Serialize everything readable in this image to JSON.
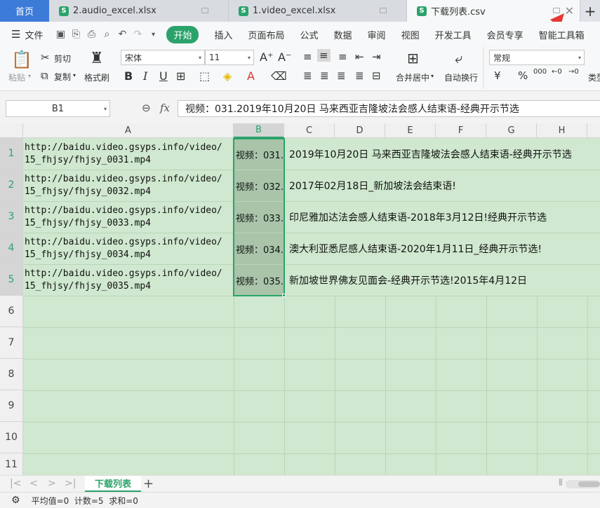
{
  "tabs": {
    "home": "首页",
    "files": [
      {
        "name": "2.audio_excel.xlsx",
        "icon": "S"
      },
      {
        "name": "1.video_excel.xlsx",
        "icon": "S"
      },
      {
        "name": "下载列表.csv",
        "icon": "S"
      }
    ],
    "add": "+"
  },
  "menu": {
    "file": "文件",
    "start": "开始",
    "items": [
      "插入",
      "页面布局",
      "公式",
      "数据",
      "审阅",
      "视图",
      "开发工具",
      "会员专享",
      "智能工具箱"
    ]
  },
  "ribbon": {
    "paste": "粘贴",
    "cut": "剪切",
    "copy": "复制",
    "format_painter": "格式刷",
    "font_name": "宋体",
    "font_size": "11",
    "merge_center": "合并居中",
    "wrap_text": "自动换行",
    "number_format": "常规",
    "type_convert": "类型",
    "currency": "¥",
    "percent": "%",
    "thousands": "000"
  },
  "formula_bar": {
    "cell_ref": "B1",
    "fx": "fx",
    "content": "视频：031.2019年10月20日 马来西亚吉隆坡法会感人结束语-经典开示节选"
  },
  "columns": [
    "A",
    "B",
    "C",
    "D",
    "E",
    "F",
    "G",
    "H"
  ],
  "rows": [
    "1",
    "2",
    "3",
    "4",
    "5",
    "6",
    "7",
    "8",
    "9",
    "10",
    "11"
  ],
  "cells": [
    {
      "a1": "http://baidu.video.gsyps.info/video/",
      "a2": "15_fhjsy/fhjsy_0031.mp4",
      "b": "视频：031.",
      "c": "2019年10月20日 马来西亚吉隆坡法会感人结束语-经典开示节选"
    },
    {
      "a1": "http://baidu.video.gsyps.info/video/",
      "a2": "15_fhjsy/fhjsy_0032.mp4",
      "b": "视频：032.",
      "c": "2017年02月18日_新加坡法会结束语!"
    },
    {
      "a1": "http://baidu.video.gsyps.info/video/",
      "a2": "15_fhjsy/fhjsy_0033.mp4",
      "b": "视频：033.",
      "c": "印尼雅加达法会感人结束语-2018年3月12日!经典开示节选"
    },
    {
      "a1": "http://baidu.video.gsyps.info/video/",
      "a2": "15_fhjsy/fhjsy_0034.mp4",
      "b": "视频：034.",
      "c": "澳大利亚悉尼感人结束语-2020年1月11日_经典开示节选!"
    },
    {
      "a1": "http://baidu.video.gsyps.info/video/",
      "a2": "15_fhjsy/fhjsy_0035.mp4",
      "b": "视频：035.",
      "c": "新加坡世界佛友见面会-经典开示节选!2015年4月12日"
    }
  ],
  "sheet": {
    "tab": "下载列表",
    "add": "+"
  },
  "status": {
    "text": "平均值=0  计数=5  求和=0"
  },
  "colors": {
    "accent": "#2aa36b",
    "home_tab": "#3d7bd9",
    "grid_bg": "#cfe8cf",
    "annotation": "#e53935"
  }
}
